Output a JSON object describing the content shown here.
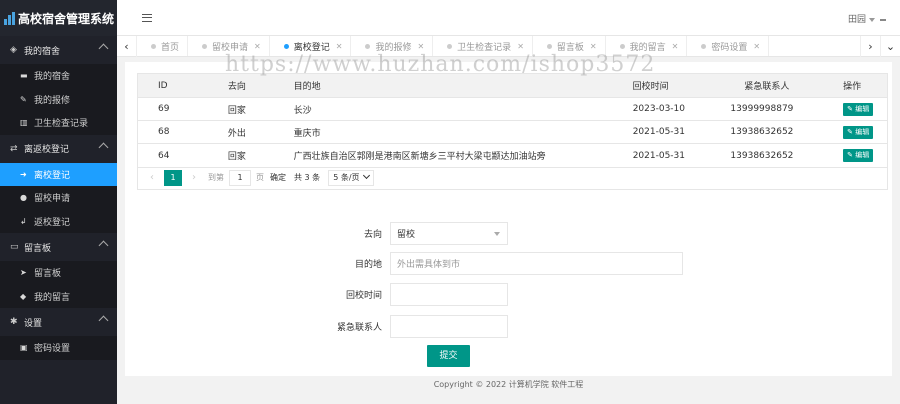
{
  "brand": {
    "title": "高校宿舍管理系统"
  },
  "header": {
    "user": "田园"
  },
  "sidebar": {
    "groups": [
      {
        "label": "我的宿舍",
        "items": [
          {
            "label": "我的宿舍"
          },
          {
            "label": "我的报修"
          },
          {
            "label": "卫生检查记录"
          }
        ]
      },
      {
        "label": "离返校登记",
        "items": [
          {
            "label": "离校登记"
          },
          {
            "label": "留校申请"
          },
          {
            "label": "返校登记"
          }
        ]
      },
      {
        "label": "留言板",
        "items": [
          {
            "label": "留言板"
          },
          {
            "label": "我的留言"
          }
        ]
      },
      {
        "label": "设置",
        "items": [
          {
            "label": "密码设置"
          }
        ]
      }
    ]
  },
  "tabs": [
    {
      "label": "首页"
    },
    {
      "label": "留校申请"
    },
    {
      "label": "离校登记"
    },
    {
      "label": "我的报修"
    },
    {
      "label": "卫生检查记录"
    },
    {
      "label": "留言板"
    },
    {
      "label": "我的留言"
    },
    {
      "label": "密码设置"
    }
  ],
  "table": {
    "headers": [
      "ID",
      "去向",
      "目的地",
      "回校时间",
      "紧急联系人",
      "操作"
    ],
    "rows": [
      {
        "id": "69",
        "direction": "回家",
        "destination": "长沙",
        "return_time": "2023-03-10",
        "contact": "13999998879",
        "action": "编辑"
      },
      {
        "id": "68",
        "direction": "外出",
        "destination": "重庆市",
        "return_time": "2021-05-31",
        "contact": "13938632652",
        "action": "编辑"
      },
      {
        "id": "64",
        "direction": "回家",
        "destination": "广西壮族自治区郭刚是港南区新塘乡三平村大梁屯颛达加油站旁",
        "return_time": "2021-05-31",
        "contact": "13938632652",
        "action": "编辑"
      }
    ]
  },
  "pager": {
    "prev": "‹",
    "current": "1",
    "next": "›",
    "goto": "到第",
    "page_input": "1",
    "page_unit": "页",
    "confirm": "确定",
    "total": "共 3 条",
    "per_page": "5 条/页"
  },
  "form": {
    "direction_label": "去向",
    "direction_value": "留校",
    "destination_label": "目的地",
    "destination_placeholder": "外出需具体到市",
    "return_label": "回校时间",
    "return_value": "",
    "contact_label": "紧急联系人",
    "contact_value": "",
    "submit": "提交"
  },
  "footer": "Copyright © 2022 计算机学院 软件工程",
  "watermark": "https://www.huzhan.com/ishop3572",
  "colors": {
    "sidebar": "#20222a",
    "active": "#1e9fff",
    "primary": "#009688"
  }
}
